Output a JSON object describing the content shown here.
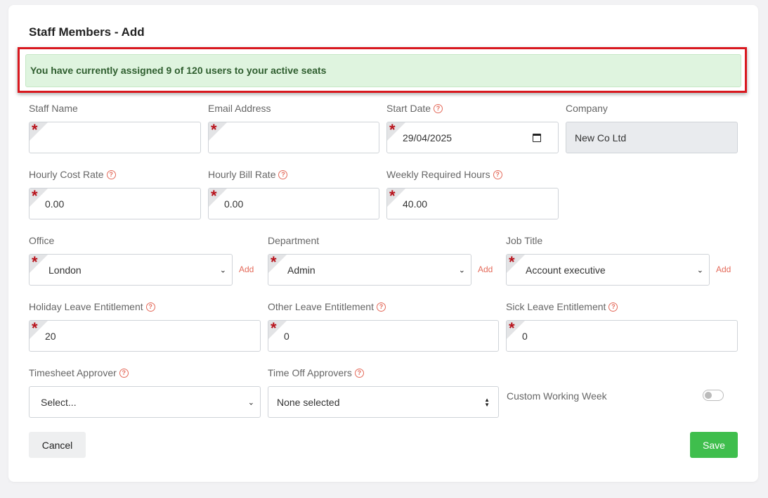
{
  "page_title": "Staff Members - Add",
  "alert_text": "You have currently assigned 9 of 120 users to your active seats",
  "help_glyph": "?",
  "required_glyph": "*",
  "add_link_label": "Add",
  "fields": {
    "staff_name": {
      "label": "Staff Name",
      "value": ""
    },
    "email_address": {
      "label": "Email Address",
      "value": ""
    },
    "start_date": {
      "label": "Start Date",
      "value": "29/04/2025"
    },
    "company": {
      "label": "Company",
      "value": "New Co Ltd"
    },
    "hourly_cost_rate": {
      "label": "Hourly Cost Rate",
      "value": "0.00"
    },
    "hourly_bill_rate": {
      "label": "Hourly Bill Rate",
      "value": "0.00"
    },
    "weekly_required_hours": {
      "label": "Weekly Required Hours",
      "value": "40.00"
    },
    "office": {
      "label": "Office",
      "value": "London"
    },
    "department": {
      "label": "Department",
      "value": "Admin"
    },
    "job_title": {
      "label": "Job Title",
      "value": "Account executive"
    },
    "holiday_leave": {
      "label": "Holiday Leave Entitlement",
      "value": "20"
    },
    "other_leave": {
      "label": "Other Leave Entitlement",
      "value": "0"
    },
    "sick_leave": {
      "label": "Sick Leave Entitlement",
      "value": "0"
    },
    "timesheet_approver": {
      "label": "Timesheet Approver",
      "value": "Select..."
    },
    "time_off_approvers": {
      "label": "Time Off Approvers",
      "value": "None selected"
    }
  },
  "custom_working_week": {
    "label": "Custom Working Week",
    "enabled": false
  },
  "buttons": {
    "cancel": "Cancel",
    "save": "Save"
  },
  "colors": {
    "accent_red": "#e46a5a",
    "required_red": "#b8121b",
    "alert_bg": "#dff4df",
    "alert_text": "#2f5e2f",
    "save_green": "#3fbe4d",
    "highlight_outline": "#d9181f"
  }
}
